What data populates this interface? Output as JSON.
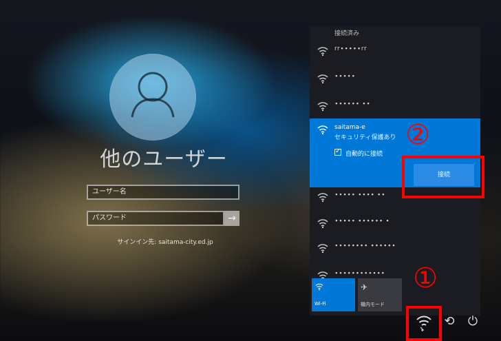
{
  "login": {
    "title": "他のユーザー",
    "username_placeholder": "ユーザー名",
    "password_placeholder": "パスワード",
    "sign_in_to": "サインイン先: saitama-city.ed.jp"
  },
  "network_flyout": {
    "connected_label": "接続済み",
    "networks": [
      {
        "name": "rr∙∙∙∙∙rr"
      },
      {
        "name": "∙∙∙∙∙"
      },
      {
        "name": "∙∙∙∙∙∙ ∙∙"
      },
      {
        "name": "saitama-e",
        "security": "セキュリティ保護あり",
        "auto_connect_label": "自動的に接続",
        "connect_button": "接続",
        "selected": true
      },
      {
        "name": "∙∙∙∙∙ ∙∙∙∙ ∙∙"
      },
      {
        "name": "∙∙∙∙∙ ∙∙∙∙∙∙ ∙"
      },
      {
        "name": "∙∙∙∙∙∙∙∙ ∙∙∙∙∙∙"
      },
      {
        "name": "∙∙∙∙∙∙∙∙∙∙∙∙"
      }
    ],
    "quick_actions": [
      {
        "label": "Wi-Fi",
        "icon": "wifi-icon",
        "active": true
      },
      {
        "label": "機内モード",
        "icon": "airplane-icon",
        "active": false
      }
    ]
  },
  "annotations": {
    "step1": "①",
    "step2": "②",
    "highlight_color": "#ff0000"
  },
  "taskbar": {
    "icons": [
      "network-icon",
      "ease-of-access-icon",
      "power-icon"
    ]
  },
  "colors": {
    "accent": "#0078d7",
    "flyout_bg": "#1b1c21"
  }
}
